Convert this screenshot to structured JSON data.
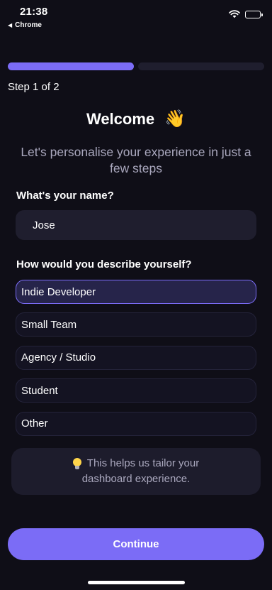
{
  "status_bar": {
    "time": "21:38",
    "back_app": "Chrome",
    "icons": [
      "back-triangle-icon",
      "wifi-icon",
      "battery-icon"
    ]
  },
  "progress": {
    "current_step": 1,
    "total_steps": 2,
    "label": "Step 1 of 2"
  },
  "header": {
    "title": "Welcome",
    "emoji": "👋",
    "subtitle": "Let's personalise your experience in just a few steps"
  },
  "name_question": {
    "label": "What's your name?",
    "value": "Jose"
  },
  "describe_question": {
    "label": "How would you describe yourself?",
    "options": [
      {
        "label": "Indie Developer",
        "selected": true
      },
      {
        "label": "Small Team",
        "selected": false
      },
      {
        "label": "Agency / Studio",
        "selected": false
      },
      {
        "label": "Student",
        "selected": false
      },
      {
        "label": "Other",
        "selected": false
      }
    ]
  },
  "tip": {
    "icon": "lightbulb-icon",
    "line1": "This helps us tailor your",
    "line2": "dashboard experience."
  },
  "continue_label": "Continue",
  "colors": {
    "background": "#0f0e17",
    "accent": "#7b6cf6",
    "surface": "#1f1e2e",
    "muted_text": "#a9a7bd"
  }
}
